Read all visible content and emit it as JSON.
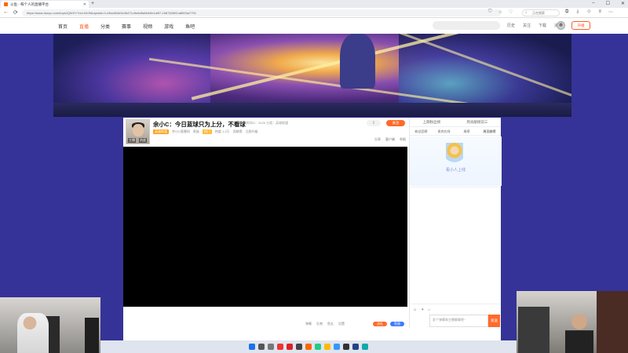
{
  "browser": {
    "tab_title": "斗鱼 - 每个人的直播平台",
    "url": "https://www.douyu.com/topic/QWXY?rid=9426&dyshid=0-c9dc8b3d3c36471c9e6d8a0b60e1a9f7-1687526f41a8000a7751",
    "search_placeholder": "正在搜索"
  },
  "site_nav": {
    "items": [
      "首页",
      "直播",
      "分类",
      "赛事",
      "视频",
      "游戏",
      "鱼吧"
    ],
    "active_index": 1,
    "header_right": [
      "历史",
      "关注",
      "下载",
      "消息"
    ],
    "live_button": "开播"
  },
  "room": {
    "title": "余小C：今日蓝球只为上分，不看球",
    "report_label": "举报",
    "subline": "房间ID：9426 分类：英雄联盟",
    "follow_label": "关注",
    "tags": [
      "主播",
      "余小C直播间",
      "金牌主播",
      "热度",
      "贡献"
    ],
    "tag_texts": [
      "英雄联盟",
      "余小C直播间",
      "贵族",
      "热门",
      "热度 1.2万",
      "贡献榜",
      "立即升级"
    ],
    "actions": [
      "分享",
      "客户端",
      "举报"
    ],
    "ctrl_labels": [
      "弹幕",
      "礼物",
      "鱼丸",
      "设置"
    ],
    "gift_label": "送礼",
    "gift2_label": "鱼翅"
  },
  "side": {
    "top_left": "上期粉丝榜",
    "top_right": "周贡献榜前三",
    "tabs": [
      "粉丝团榜",
      "贵宾在线",
      "周榜",
      "周贡献榜"
    ],
    "promo_text": "看小人上线",
    "chat_placeholder": "发个弹幕和主播聊聊吧~",
    "send_label": "发送"
  },
  "colors": {
    "brand": "#ff6b2b",
    "background": "#353397"
  }
}
